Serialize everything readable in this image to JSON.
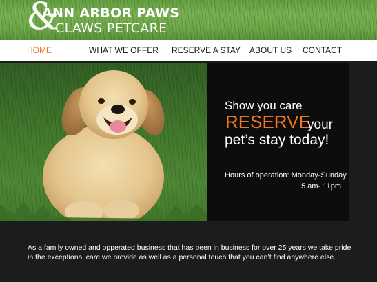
{
  "brand": {
    "ampersand": "&",
    "line1": "ANN ARBOR PAWS",
    "line2": "CLAWS PETCARE"
  },
  "nav": {
    "items": [
      {
        "label": "HOME",
        "active": true
      },
      {
        "label": "WHAT WE OFFER",
        "active": false
      },
      {
        "label": "RESERVE A STAY",
        "active": false
      },
      {
        "label": "ABOUT US",
        "active": false
      },
      {
        "label": "CONTACT",
        "active": false
      }
    ]
  },
  "hero": {
    "image": "golden-retriever-puppy-on-grass",
    "line1": "Show you care",
    "reserve": "RESERVE",
    "your": "your",
    "line3": "pet’s stay today!",
    "hours_line1": "Hours of operation: Monday-Sunday",
    "hours_line2": "5 am- 11pm"
  },
  "body": {
    "text": "As a family owned and opperated business that has been in business for over 25 years we take pride in the exceptional care we provide as well as a personal touch that you can’t find anywhere else."
  },
  "colors": {
    "accent": "#ee7624",
    "page_bg": "#1b1c1c",
    "panel_bg": "#0d0d0d",
    "grass": "#6aa444"
  }
}
